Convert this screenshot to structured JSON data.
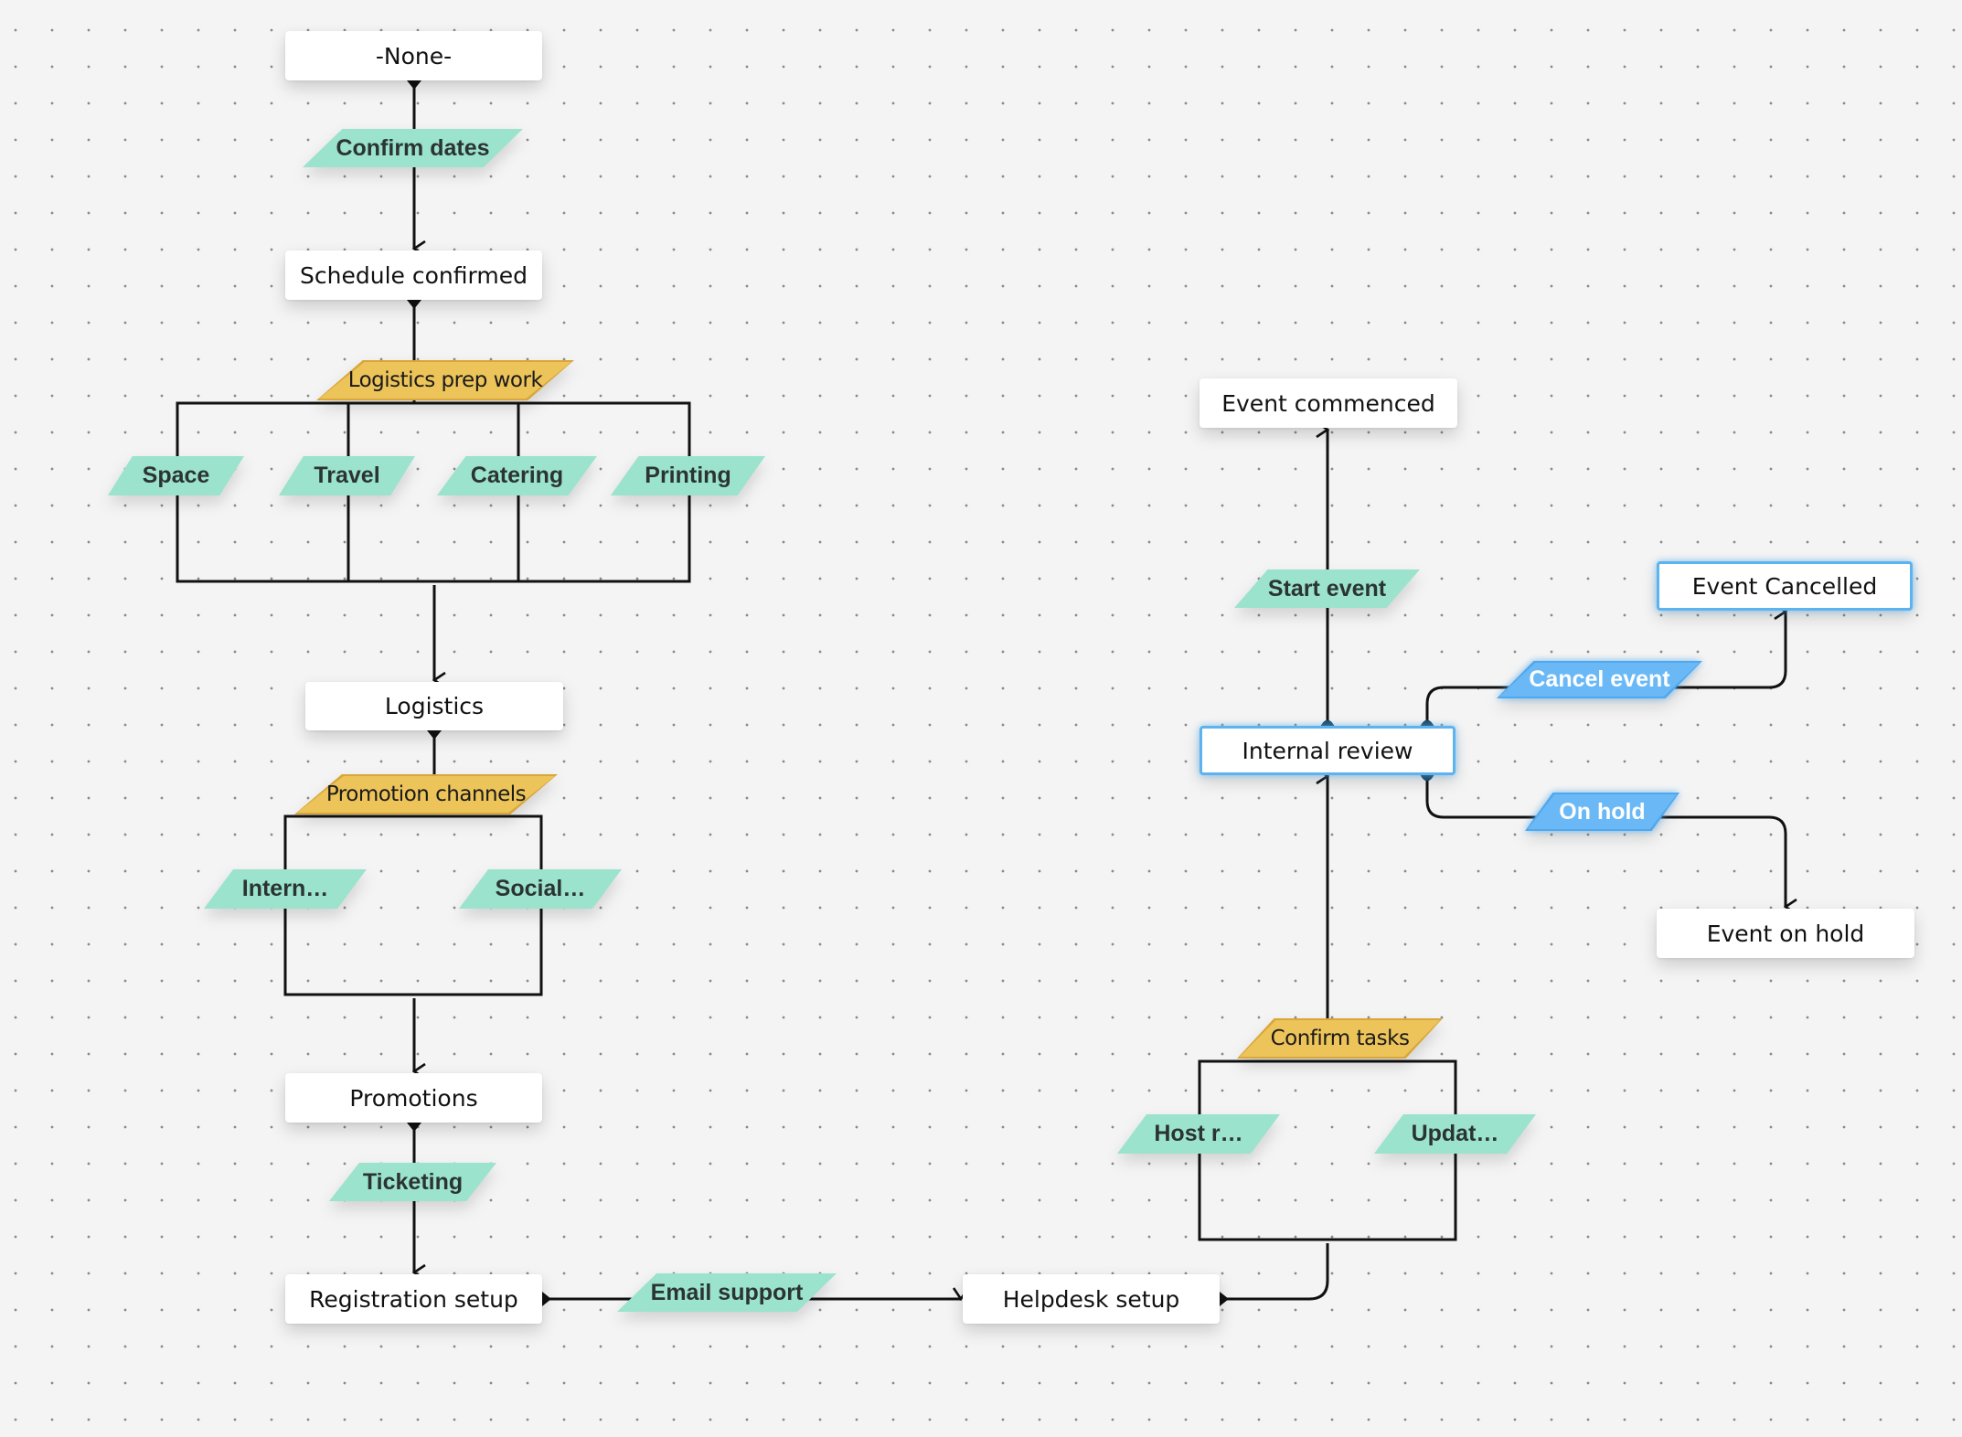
{
  "diagram": {
    "type": "workflow",
    "states": {
      "none": "-None-",
      "schedule_confirmed": "Schedule confirmed",
      "logistics": "Logistics",
      "promotions": "Promotions",
      "registration_setup": "Registration setup",
      "helpdesk_setup": "Helpdesk setup",
      "internal_review": "Internal review",
      "event_commenced": "Event commenced",
      "event_cancelled": "Event Cancelled",
      "event_on_hold": "Event on hold"
    },
    "transitions": {
      "confirm_dates": "Confirm dates",
      "logistics_prep_work": "Logistics prep work",
      "space": "Space",
      "travel": "Travel",
      "catering": "Catering",
      "printing": "Printing",
      "promotion_channels": "Promotion channels",
      "internal": "Intern…",
      "social": "Social…",
      "ticketing": "Ticketing",
      "email_support": "Email support",
      "confirm_tasks": "Confirm tasks",
      "host_r": "Host r…",
      "updat": "Updat…",
      "start_event": "Start event",
      "cancel_event": "Cancel event",
      "on_hold": "On hold"
    },
    "edges": [
      {
        "from": "-None-",
        "via": "Confirm dates",
        "to": "Schedule confirmed"
      },
      {
        "from": "Schedule confirmed",
        "via": "Logistics prep work",
        "to": "Logistics",
        "parallel": [
          "Space",
          "Travel",
          "Catering",
          "Printing"
        ]
      },
      {
        "from": "Logistics",
        "via": "Promotion channels",
        "to": "Promotions",
        "parallel": [
          "Intern…",
          "Social…"
        ]
      },
      {
        "from": "Promotions",
        "via": "Ticketing",
        "to": "Registration setup"
      },
      {
        "from": "Registration setup",
        "via": "Email support",
        "to": "Helpdesk setup"
      },
      {
        "from": "Helpdesk setup",
        "via": "Confirm tasks",
        "to": "Internal review",
        "parallel": [
          "Host r…",
          "Updat…"
        ]
      },
      {
        "from": "Internal review",
        "via": "Start event",
        "to": "Event commenced"
      },
      {
        "from": "Internal review",
        "via": "Cancel event",
        "to": "Event Cancelled"
      },
      {
        "from": "Internal review",
        "via": "On hold",
        "to": "Event on hold"
      }
    ],
    "colors": {
      "background": "#f4f4f4",
      "transition_teal": "#9be3cd",
      "parallel_yellow": "#edc45a",
      "selected_blue": "#6ab9f6",
      "selected_border": "#5cb3ef",
      "line": "#111111"
    }
  }
}
